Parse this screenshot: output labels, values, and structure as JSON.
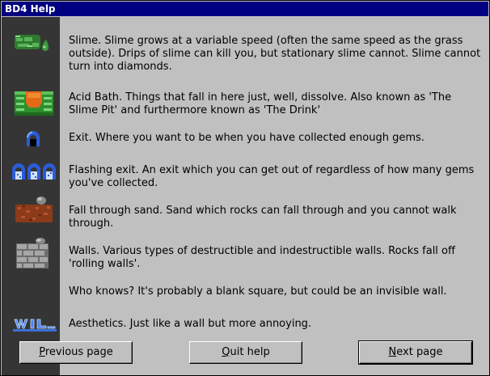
{
  "window": {
    "title": "BD4 Help"
  },
  "entries": [
    {
      "icon": "slime-icon",
      "text": "Slime. Slime grows at a variable speed (often the same speed as the grass outside). Drips of slime can kill you, but stationary slime cannot. Slime cannot turn into diamonds."
    },
    {
      "icon": "acid-bath-icon",
      "text": "Acid Bath. Things that fall in here just, well, dissolve. Also known as 'The Slime Pit' and furthermore known as 'The Drink'"
    },
    {
      "icon": "exit-icon",
      "text": "Exit. Where you want to be when you have collected enough gems."
    },
    {
      "icon": "flashing-exit-icon",
      "text": "Flashing exit. An exit which you can get out of regardless of how many gems you've collected."
    },
    {
      "icon": "fall-through-sand-icon",
      "text": "Fall through sand. Sand which rocks can fall through and you cannot walk through."
    },
    {
      "icon": "walls-icon",
      "text": "Walls. Various types of destructible and indestructible walls. Rocks fall off 'rolling walls'."
    },
    {
      "icon": "blank-square-icon",
      "text": "Who knows? It's probably a blank square, but could be an invisible wall."
    },
    {
      "icon": "aesthetics-icon",
      "text": "Aesthetics. Just like a wall but more annoying."
    }
  ],
  "buttons": {
    "previous": {
      "mnemonic": "P",
      "rest": "revious page"
    },
    "quit": {
      "mnemonic": "Q",
      "rest": "uit help"
    },
    "next": {
      "mnemonic": "N",
      "rest": "ext page"
    }
  }
}
